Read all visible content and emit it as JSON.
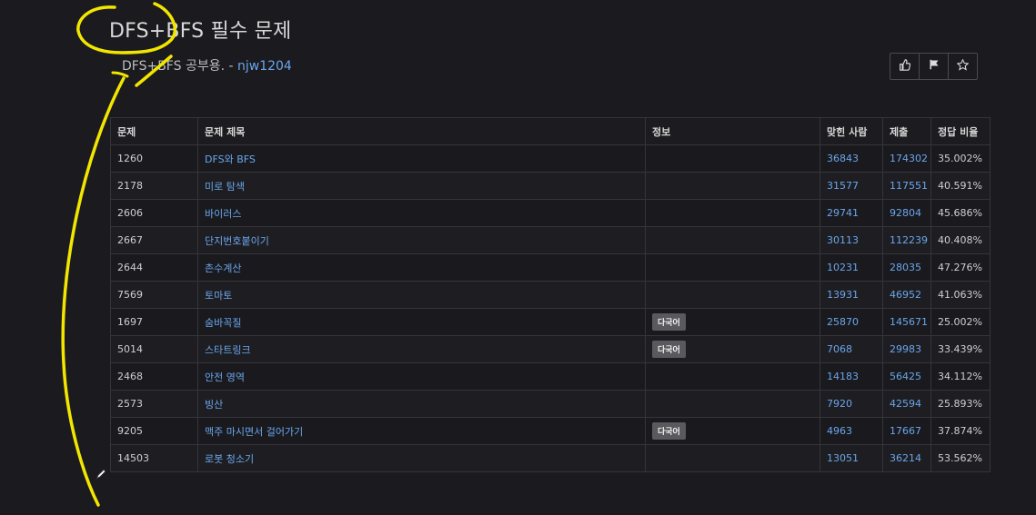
{
  "header": {
    "title": "DFS+BFS 필수 문제",
    "subtitle_prefix": "DFS+BFS 공부용. - ",
    "author": "njw1204"
  },
  "actions": [
    {
      "name": "like-icon",
      "glyph": "👍"
    },
    {
      "name": "flag-icon",
      "glyph": "⚑"
    },
    {
      "name": "star-icon",
      "glyph": "☆"
    }
  ],
  "table": {
    "headers": [
      "문제",
      "문제 제목",
      "정보",
      "맞힌 사람",
      "제출",
      "정답 비율"
    ],
    "rows": [
      {
        "id": "1260",
        "title": "DFS와 BFS",
        "info": "",
        "solved": "36843",
        "submissions": "174302",
        "ratio": "35.002%"
      },
      {
        "id": "2178",
        "title": "미로 탐색",
        "info": "",
        "solved": "31577",
        "submissions": "117551",
        "ratio": "40.591%"
      },
      {
        "id": "2606",
        "title": "바이러스",
        "info": "",
        "solved": "29741",
        "submissions": "92804",
        "ratio": "45.686%"
      },
      {
        "id": "2667",
        "title": "단지번호붙이기",
        "info": "",
        "solved": "30113",
        "submissions": "112239",
        "ratio": "40.408%"
      },
      {
        "id": "2644",
        "title": "촌수계산",
        "info": "",
        "solved": "10231",
        "submissions": "28035",
        "ratio": "47.276%"
      },
      {
        "id": "7569",
        "title": "토마토",
        "info": "",
        "solved": "13931",
        "submissions": "46952",
        "ratio": "41.063%"
      },
      {
        "id": "1697",
        "title": "숨바꼭질",
        "info": "다국어",
        "solved": "25870",
        "submissions": "145671",
        "ratio": "25.002%"
      },
      {
        "id": "5014",
        "title": "스타트링크",
        "info": "다국어",
        "solved": "7068",
        "submissions": "29983",
        "ratio": "33.439%"
      },
      {
        "id": "2468",
        "title": "안전 영역",
        "info": "",
        "solved": "14183",
        "submissions": "56425",
        "ratio": "34.112%"
      },
      {
        "id": "2573",
        "title": "빙산",
        "info": "",
        "solved": "7920",
        "submissions": "42594",
        "ratio": "25.893%"
      },
      {
        "id": "9205",
        "title": "맥주 마시면서 걸어가기",
        "info": "다국어",
        "solved": "4963",
        "submissions": "17667",
        "ratio": "37.874%"
      },
      {
        "id": "14503",
        "title": "로봇 청소기",
        "info": "",
        "solved": "13051",
        "submissions": "36214",
        "ratio": "53.562%"
      }
    ]
  },
  "colors": {
    "background": "#1b1a1f",
    "link": "#6aa6ec",
    "annotation": "#f2e600"
  }
}
